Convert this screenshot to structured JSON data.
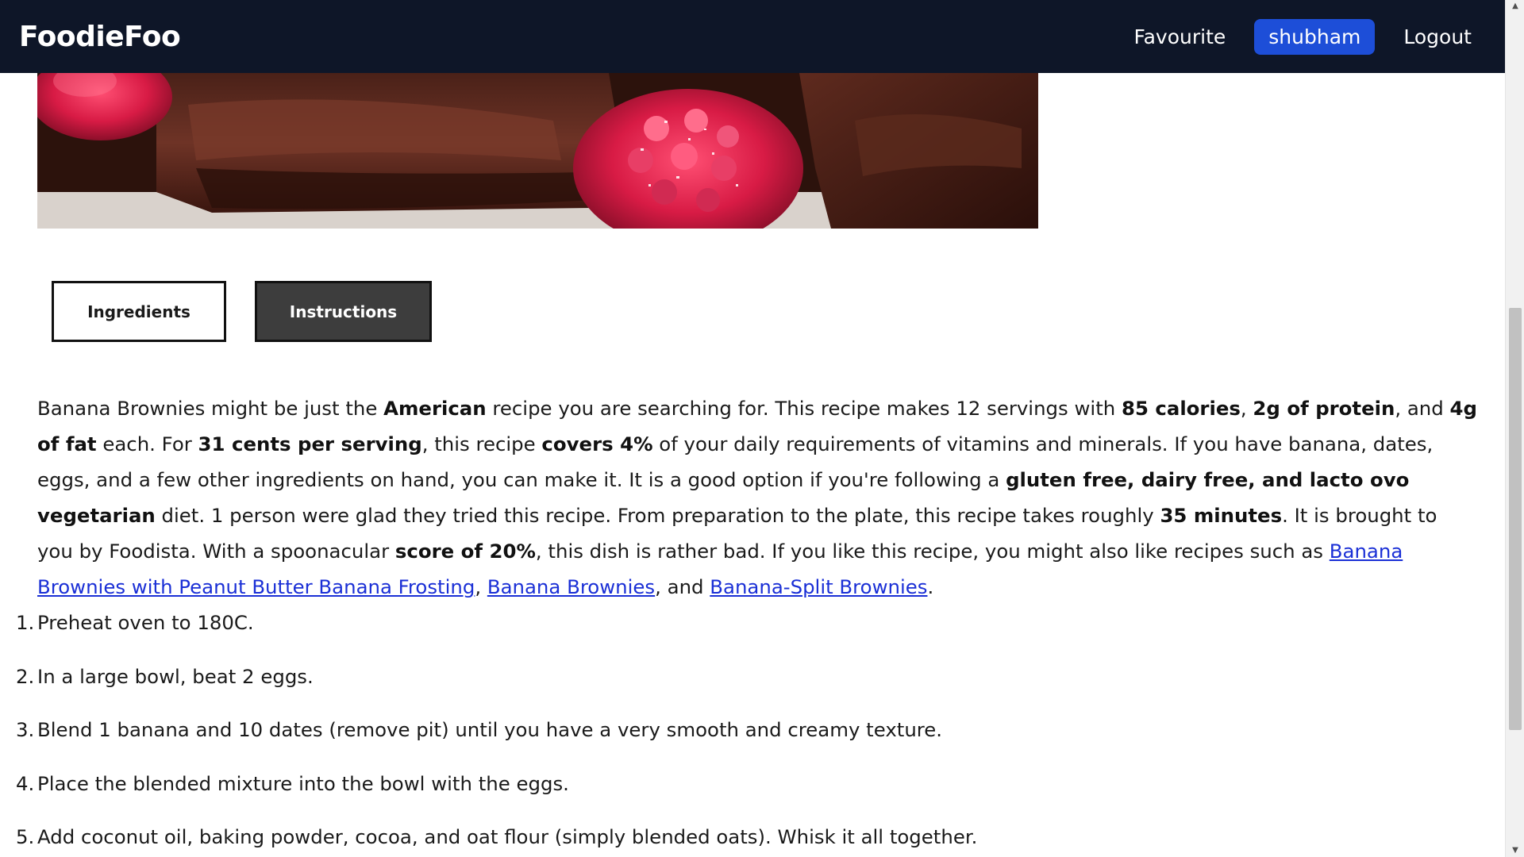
{
  "navbar": {
    "brand": "FoodieFoo",
    "links": [
      {
        "label": "Favourite",
        "active": false
      },
      {
        "label": "shubham",
        "active": true
      },
      {
        "label": "Logout",
        "active": false
      }
    ],
    "active_color": "#1d4ed8",
    "background": "#0e1628"
  },
  "tabs": {
    "ingredients": "Ingredients",
    "instructions": "Instructions",
    "selected": "Instructions"
  },
  "summary": {
    "s1": "Banana Brownies might be just the ",
    "b1": "American",
    "s2": " recipe you are searching for. This recipe makes 12 servings with ",
    "b2": "85 calories",
    "s3": ", ",
    "b3": "2g of protein",
    "s4": ", and ",
    "b4": "4g of fat",
    "s5": " each. For ",
    "b5": "31 cents per serving",
    "s6": ", this recipe ",
    "b6": "covers 4%",
    "s7": " of your daily requirements of vitamins and minerals. If you have banana, dates, eggs, and a few other ingredients on hand, you can make it. It is a good option if you're following a ",
    "b7": "gluten free, dairy free, and lacto ovo vegetarian",
    "s8": " diet. 1 person were glad they tried this recipe. From preparation to the plate, this recipe takes roughly ",
    "b8": "35 minutes",
    "s9": ". It is brought to you by Foodista. With a spoonacular ",
    "b9": "score of 20%",
    "s10": ", this dish is rather bad. If you like this recipe, you might also like recipes such as ",
    "link1": "Banana Brownies with Peanut Butter Banana Frosting",
    "s11": ", ",
    "link2": "Banana Brownies",
    "s12": ", and ",
    "link3": "Banana-Split Brownies",
    "s13": "."
  },
  "steps": [
    {
      "num": "1.",
      "text": "Preheat oven to 180C."
    },
    {
      "num": "2.",
      "text": "In a large bowl, beat 2 eggs."
    },
    {
      "num": "3.",
      "text": "Blend 1 banana and 10 dates (remove pit) until you have a very smooth and creamy texture."
    },
    {
      "num": "4.",
      "text": "Place the blended mixture into the bowl with the eggs."
    },
    {
      "num": "5.",
      "text": "Add coconut oil, baking powder, cocoa, and oat flour (simply blended oats). Whisk it all together."
    }
  ],
  "link_color": "#1a2fd6"
}
